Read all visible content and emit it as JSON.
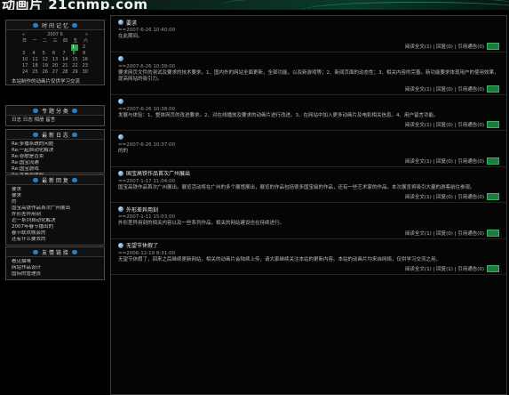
{
  "logo": "动画片 21cnmp.com",
  "calendar": {
    "title": "时 间 记 忆",
    "month": "2007 6",
    "weekdays": [
      "日",
      "一",
      "二",
      "三",
      "四",
      "五",
      "六"
    ],
    "rows": [
      [
        "",
        "",
        "",
        "",
        "",
        "1",
        "2"
      ],
      [
        "3",
        "4",
        "5",
        "6",
        "7",
        "8",
        "9"
      ],
      [
        "10",
        "11",
        "12",
        "13",
        "14",
        "15",
        "16"
      ],
      [
        "17",
        "18",
        "19",
        "20",
        "21",
        "22",
        "23"
      ],
      [
        "24",
        "25",
        "26",
        "27",
        "28",
        "29",
        "30"
      ]
    ],
    "today": "1",
    "note": "本站制作的动画片仅供学习交流"
  },
  "sidebar": {
    "search_title": "专 题 分 类",
    "search_links": "日志 日志 相册 留言",
    "recent_title": "最 新 日 志",
    "recent_items": [
      "Re:多播系统的问题",
      "Re:一起自动化解决",
      "Re:谷歌是否卖",
      "Re:国宝流通",
      "Re:国宝游戏",
      "Re:发展与体验"
    ],
    "comments_title": "最 新 回 复",
    "comments_items": [
      "要求",
      "要求",
      "的",
      "国宝高铁作品首次广州展出",
      "外形差异用刻",
      "近一系列自动化解决",
      "2007年春节播出的",
      "春节联欢晚会的",
      "还有什么要去的"
    ],
    "links_title": "友 情 链 接",
    "links_items": [
      "看见猫咪",
      "网站作品设计",
      "国际的管理员"
    ]
  },
  "posts": [
    {
      "title": "要求",
      "date": "==2007-6-26 10:40:00",
      "body": "在此期间。",
      "foot": "阅读全文(1) | 回复(0) | 引用通告(0)"
    },
    {
      "title": "",
      "date": "==2007-6-26 10:39:00",
      "body": "要求网页文件的测试及要求的技术要求。1、国内外的网站全面更新，全部功能，以及新游戏等；2、新闻页面的动态性；3、相关内容的完善。新功能要求体现用户的使用效果，提高网站的吸引力。",
      "foot": "阅读全文(1) | 回复(0) | 引用通告(0)"
    },
    {
      "title": "",
      "date": "==2007-6-26 10:38:00",
      "body": "发展与体验：1、整体网页的改进要求。2、对在线播放及要求的动画片进行改进。3、在网站中加入更多动画片及电影相关信息。4、用户留言功能。",
      "foot": "阅读全文(1) | 回复(0) | 引用通告(0)"
    },
    {
      "title": "",
      "date": "==2007-6-26 10:37:00",
      "body": "的的",
      "foot": "阅读全文(1) | 回复(0) | 引用通告(0)"
    },
    {
      "title": "国宝高铁作品首次广州展出",
      "date": "==2007-1-17 11:04:00",
      "body": "国宝高铁作品首次广州展出。展览活动将在广州的多个展馆展出，展览的作品包括很多国宝级的作品，还有一些艺术家的作品。本次展览将吸引大量的游客前往参观。",
      "foot": "阅读全文(1) | 回复(0) | 引用通告(0)"
    },
    {
      "title": "外形差异用刻",
      "date": "==2007-1-11 15:03:00",
      "body": "外形差异用刻的相关内容以及一些系列作品，相关的网站建设也在持续进行。",
      "foot": "阅读全文(1) | 回复(0) | 引用通告(0)"
    },
    {
      "title": "无望节休假了",
      "date": "==2006-12-19 8:31:00",
      "body": "无望节休假了，回来之后继续更新网站，相关的动画片会陆续上传，请大家继续关注本站的更新内容。本站的动画片均来自网络，仅供学习交流之用。",
      "foot": "阅读全文(1) | 回复(1) | 引用通告(0)"
    }
  ]
}
